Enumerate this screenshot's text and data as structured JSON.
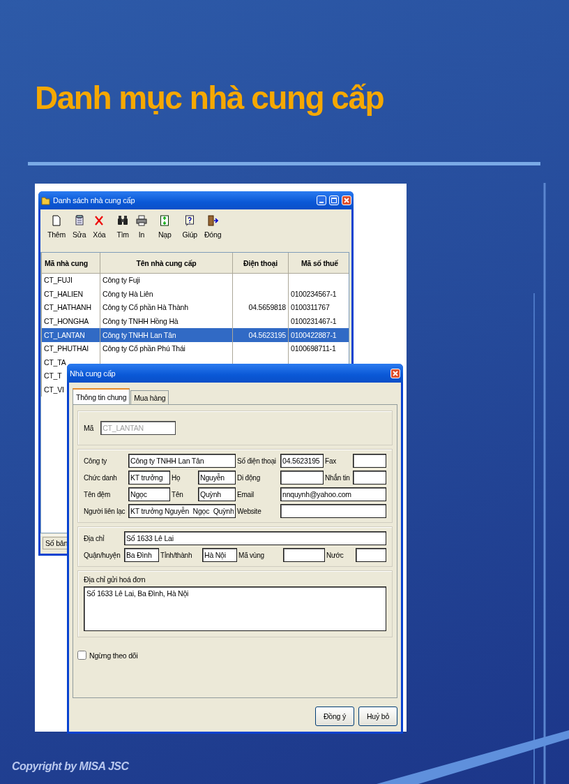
{
  "slide": {
    "title": "Danh mục nhà cung cấp",
    "footer": "Copyright by MISA JSC"
  },
  "list_window": {
    "title": "Danh sách nhà cung cấp",
    "toolbar": [
      {
        "label": "Thêm",
        "kind": "new"
      },
      {
        "label": "Sửa",
        "kind": "edit"
      },
      {
        "label": "Xóa",
        "kind": "delete"
      },
      {
        "label": "Tìm",
        "kind": "find"
      },
      {
        "label": "In",
        "kind": "print"
      },
      {
        "label": "Nạp",
        "kind": "reload"
      },
      {
        "label": "Giúp",
        "kind": "help"
      },
      {
        "label": "Đóng",
        "kind": "exit"
      }
    ],
    "table": {
      "columns": [
        "Mã nhà cung",
        "Tên nhà cung cấp",
        "Điện thoại",
        "Mã số thuế"
      ],
      "rows": [
        {
          "cells": [
            "CT_FUJI",
            "Công ty Fuji",
            "",
            ""
          ],
          "selected": false
        },
        {
          "cells": [
            "CT_HALIEN",
            "Công ty Hà Liên",
            "",
            "0100234567-1"
          ],
          "selected": false
        },
        {
          "cells": [
            "CT_HATHANH",
            "Công ty Cổ phần Hà Thành",
            "04.5659818",
            "0100311767"
          ],
          "selected": false
        },
        {
          "cells": [
            "CT_HONGHA",
            "Công ty TNHH Hồng Hà",
            "",
            "0100231467-1"
          ],
          "selected": false
        },
        {
          "cells": [
            "CT_LANTAN",
            "Công ty TNHH Lan Tân",
            "04.5623195",
            "0100422887-1"
          ],
          "selected": true
        },
        {
          "cells": [
            "CT_PHUTHAI",
            "Công ty Cổ phần Phú Thái",
            "",
            "0100698711-1"
          ],
          "selected": false
        },
        {
          "cells": [
            "CT_TA"
          ],
          "selected": false
        },
        {
          "cells": [
            "CT_T"
          ],
          "selected": false
        },
        {
          "cells": [
            "CT_VI"
          ],
          "selected": false
        }
      ]
    },
    "status_bar": "Số bản"
  },
  "dialog": {
    "title": "Nhà cung cấp",
    "tabs": [
      {
        "label": "Thông tin chung",
        "selected": true
      },
      {
        "label": "Mua hàng",
        "selected": false
      }
    ],
    "code": {
      "label": "Mã",
      "value": "CT_LANTAN",
      "disabled": true
    },
    "contact_rows": [
      [
        {
          "label": "Công ty",
          "value": "Công ty TNHH Lan Tân"
        },
        {
          "label": "Số điện thoại",
          "value": "04.5623195"
        },
        {
          "label": "Fax"
        }
      ],
      [
        {
          "label": "Chức danh",
          "value": "KT trưởng"
        },
        {
          "label": "Họ",
          "value": "Nguyễn"
        },
        {
          "label": "Di động"
        },
        {
          "label": "Nhắn tin"
        }
      ],
      [
        {
          "label": "Tên đệm",
          "value": "Ngọc"
        },
        {
          "label": "Tên",
          "value": "Quỳnh"
        },
        {
          "label": "Email",
          "value": "nnquynh@yahoo.com"
        }
      ],
      [
        {
          "label": "Người liên lạc",
          "value": "KT trưởng Nguyễn  Ngọc  Quỳnh"
        },
        {
          "label": "Website"
        }
      ]
    ],
    "address_rows": [
      [
        {
          "label": "Địa chỉ",
          "value": "Số 1633 Lê Lai"
        }
      ],
      [
        {
          "label": "Quận/huyện",
          "value": "Ba Đình"
        },
        {
          "label": "Tỉnh/thành",
          "value": "Hà Nội"
        },
        {
          "label": "Mã vùng"
        },
        {
          "label": "Nước"
        }
      ]
    ],
    "invoice_address": {
      "label": "Địa chỉ gửi hoá đơn",
      "value": "Số 1633 Lê Lai, Ba Đình, Hà Nội"
    },
    "inactive": {
      "label": "Ngừng theo dõi",
      "checked": false
    },
    "buttons": [
      "Đồng ý",
      "Huỷ bỏ"
    ]
  }
}
